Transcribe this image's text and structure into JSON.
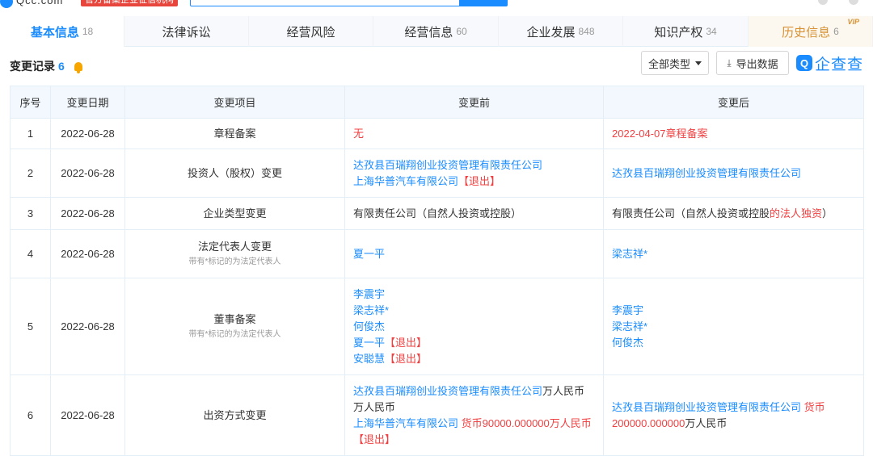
{
  "header": {
    "logo_text": "Qcc.com",
    "logo_badge": "官方备案企业征信机构"
  },
  "tabs": [
    {
      "label": "基本信息",
      "count": "18"
    },
    {
      "label": "法律诉讼",
      "count": ""
    },
    {
      "label": "经营风险",
      "count": ""
    },
    {
      "label": "经营信息",
      "count": "60"
    },
    {
      "label": "企业发展",
      "count": "848"
    },
    {
      "label": "知识产权",
      "count": "34"
    },
    {
      "label": "历史信息",
      "count": "6",
      "vip": "VIP"
    }
  ],
  "section": {
    "title": "变更记录",
    "count": "6",
    "filter_label": "全部类型",
    "export_label": "导出数据",
    "export_icon": "download-icon",
    "brand_text": "企查查",
    "brand_mark": "Q"
  },
  "table": {
    "headers": [
      "序号",
      "变更日期",
      "变更项目",
      "变更前",
      "变更后"
    ],
    "rows": [
      {
        "no": "1",
        "date": "2022-06-28",
        "item": "章程备案",
        "item_note": "",
        "before": [
          {
            "t": "无",
            "c": "red"
          }
        ],
        "after": [
          {
            "t": "2022-04-07章程备案",
            "c": "red"
          }
        ]
      },
      {
        "no": "2",
        "date": "2022-06-28",
        "item": "投资人（股权）变更",
        "item_note": "",
        "before": [
          {
            "t": "达孜县百瑞翔创业投资管理有限责任公司",
            "c": "lnk"
          },
          {
            "t": "上海华普汽车有限公司",
            "c": "lnk",
            "suffix": "【退出】",
            "sc": "red"
          }
        ],
        "after": [
          {
            "t": "达孜县百瑞翔创业投资管理有限责任公司",
            "c": "lnk"
          }
        ]
      },
      {
        "no": "3",
        "date": "2022-06-28",
        "item": "企业类型变更",
        "item_note": "",
        "before": [
          {
            "t": "有限责任公司（自然人投资或控股）",
            "c": "blk"
          }
        ],
        "after": [
          {
            "t": "有限责任公司（自然人投资或控股",
            "c": "blk",
            "suffix": "的法人独资",
            "sc": "red",
            "tail": "）"
          }
        ]
      },
      {
        "no": "4",
        "date": "2022-06-28",
        "item": "法定代表人变更",
        "item_note": "带有*标记的为法定代表人",
        "before": [
          {
            "t": "夏一平",
            "c": "lnk"
          }
        ],
        "after": [
          {
            "t": "梁志祥*",
            "c": "lnk"
          }
        ]
      },
      {
        "no": "5",
        "date": "2022-06-28",
        "item": "董事备案",
        "item_note": "带有*标记的为法定代表人",
        "before": [
          {
            "t": "李震宇",
            "c": "lnk"
          },
          {
            "t": "梁志祥*",
            "c": "lnk"
          },
          {
            "t": "何俊杰",
            "c": "lnk"
          },
          {
            "t": "夏一平",
            "c": "lnk",
            "suffix": "【退出】",
            "sc": "red"
          },
          {
            "t": "安聪慧",
            "c": "lnk",
            "suffix": "【退出】",
            "sc": "red"
          }
        ],
        "after": [
          {
            "t": "李震宇",
            "c": "lnk"
          },
          {
            "t": "梁志祥*",
            "c": "lnk"
          },
          {
            "t": "何俊杰",
            "c": "lnk"
          }
        ]
      },
      {
        "no": "6",
        "date": "2022-06-28",
        "item": "出资方式变更",
        "item_note": "",
        "before": [
          {
            "t": "达孜县百瑞翔创业投资管理有限责任公司",
            "c": "lnk",
            "suffix": "万人民币万人民币",
            "sc": "blk"
          },
          {
            "t": "上海华普汽车有限公司",
            "c": "lnk",
            "suffix": " 货币90000.000000万人民币",
            "sc": "red"
          },
          {
            "t": "",
            "c": "lnk",
            "suffix": "【退出】",
            "sc": "red"
          }
        ],
        "after": [
          {
            "t": "达孜县百瑞翔创业投资管理有限责任公司",
            "c": "lnk",
            "suffix": " 货币200000.000000",
            "sc": "red",
            "tail": "万人民币"
          }
        ]
      }
    ]
  }
}
